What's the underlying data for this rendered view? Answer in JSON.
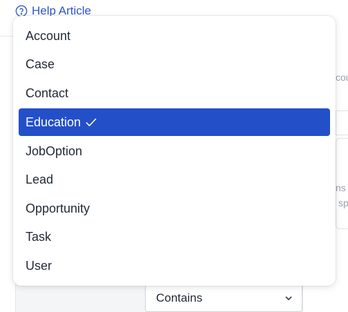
{
  "header": {
    "help_label": "Help Article"
  },
  "background": {
    "right_fragment_1": "cou",
    "right_fragment_2": "ns",
    "right_fragment_3": "sp",
    "filter_select_value": "Contains"
  },
  "dropdown": {
    "options": [
      {
        "label": "Account",
        "selected": false
      },
      {
        "label": "Case",
        "selected": false
      },
      {
        "label": "Contact",
        "selected": false
      },
      {
        "label": "Education",
        "selected": true
      },
      {
        "label": "JobOption",
        "selected": false
      },
      {
        "label": "Lead",
        "selected": false
      },
      {
        "label": "Opportunity",
        "selected": false
      },
      {
        "label": "Task",
        "selected": false
      },
      {
        "label": "User",
        "selected": false
      }
    ],
    "selected_color": "#2350c8"
  },
  "icons": {
    "help": "question-circle-icon",
    "check": "checkmark-icon",
    "chevron": "chevron-down-icon"
  }
}
